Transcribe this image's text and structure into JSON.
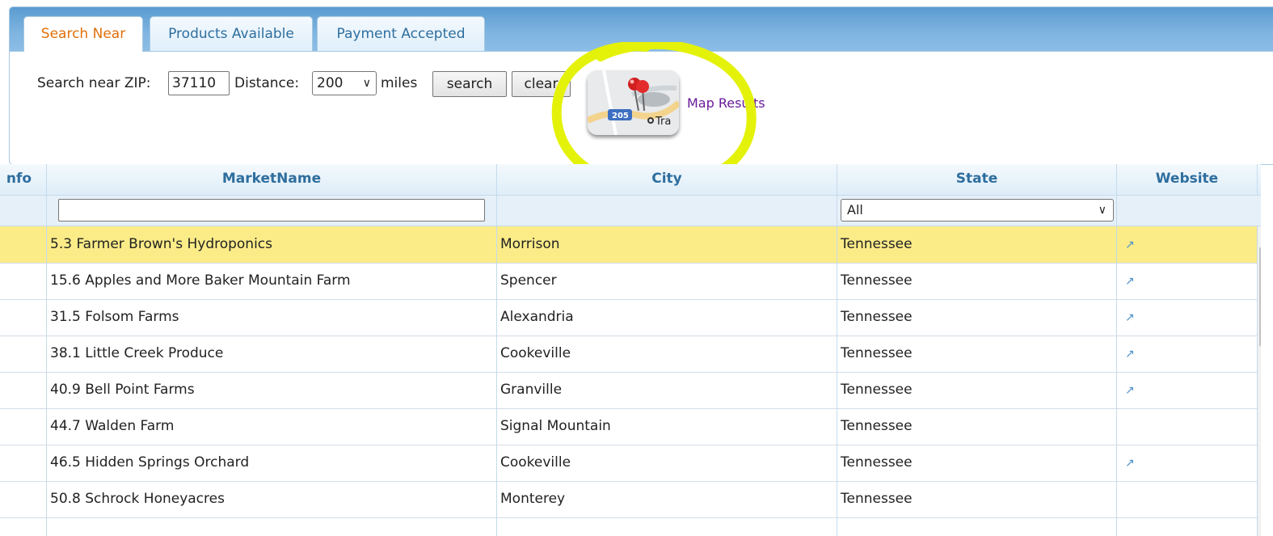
{
  "tabs": [
    {
      "label": "Search Near",
      "active": true
    },
    {
      "label": "Products Available",
      "active": false
    },
    {
      "label": "Payment Accepted",
      "active": false
    }
  ],
  "search": {
    "zip_label": "Search near ZIP:",
    "zip_value": "37110",
    "distance_label": "Distance:",
    "distance_value": "200",
    "miles_label": "miles",
    "search_button": "search",
    "clear_button": "clear",
    "map_link": "Map Results",
    "map_thumb_route": "205",
    "map_thumb_text": "Tra"
  },
  "columns": [
    "nfo",
    "MarketName",
    "City",
    "State",
    "Website"
  ],
  "filters": {
    "state_value": "All"
  },
  "rows": [
    {
      "market": "5.3 Farmer Brown's Hydroponics",
      "city": "Morrison",
      "state": "Tennessee",
      "website": true,
      "selected": true
    },
    {
      "market": "15.6 Apples and More Baker Mountain Farm",
      "city": "Spencer",
      "state": "Tennessee",
      "website": true
    },
    {
      "market": "31.5 Folsom Farms",
      "city": "Alexandria",
      "state": "Tennessee",
      "website": true
    },
    {
      "market": "38.1 Little Creek Produce",
      "city": "Cookeville",
      "state": "Tennessee",
      "website": true
    },
    {
      "market": "40.9 Bell Point Farms",
      "city": "Granville",
      "state": "Tennessee",
      "website": true
    },
    {
      "market": "44.7 Walden Farm",
      "city": "Signal Mountain",
      "state": "Tennessee",
      "website": false
    },
    {
      "market": "46.5 Hidden Springs Orchard",
      "city": "Cookeville",
      "state": "Tennessee",
      "website": true
    },
    {
      "market": "50.8 Schrock Honeyacres",
      "city": "Monterey",
      "state": "Tennessee",
      "website": false
    }
  ],
  "colors": {
    "tab_active_text": "#e17009",
    "tab_text": "#2e6e9e",
    "header_text": "#2e6e9e",
    "selected_row": "#fbec88",
    "annotation_circle": "#e4f20a",
    "map_link": "#6a1b9a"
  },
  "icons": {
    "website_link": "external-link-icon",
    "dropdown": "chevron-down-icon"
  }
}
